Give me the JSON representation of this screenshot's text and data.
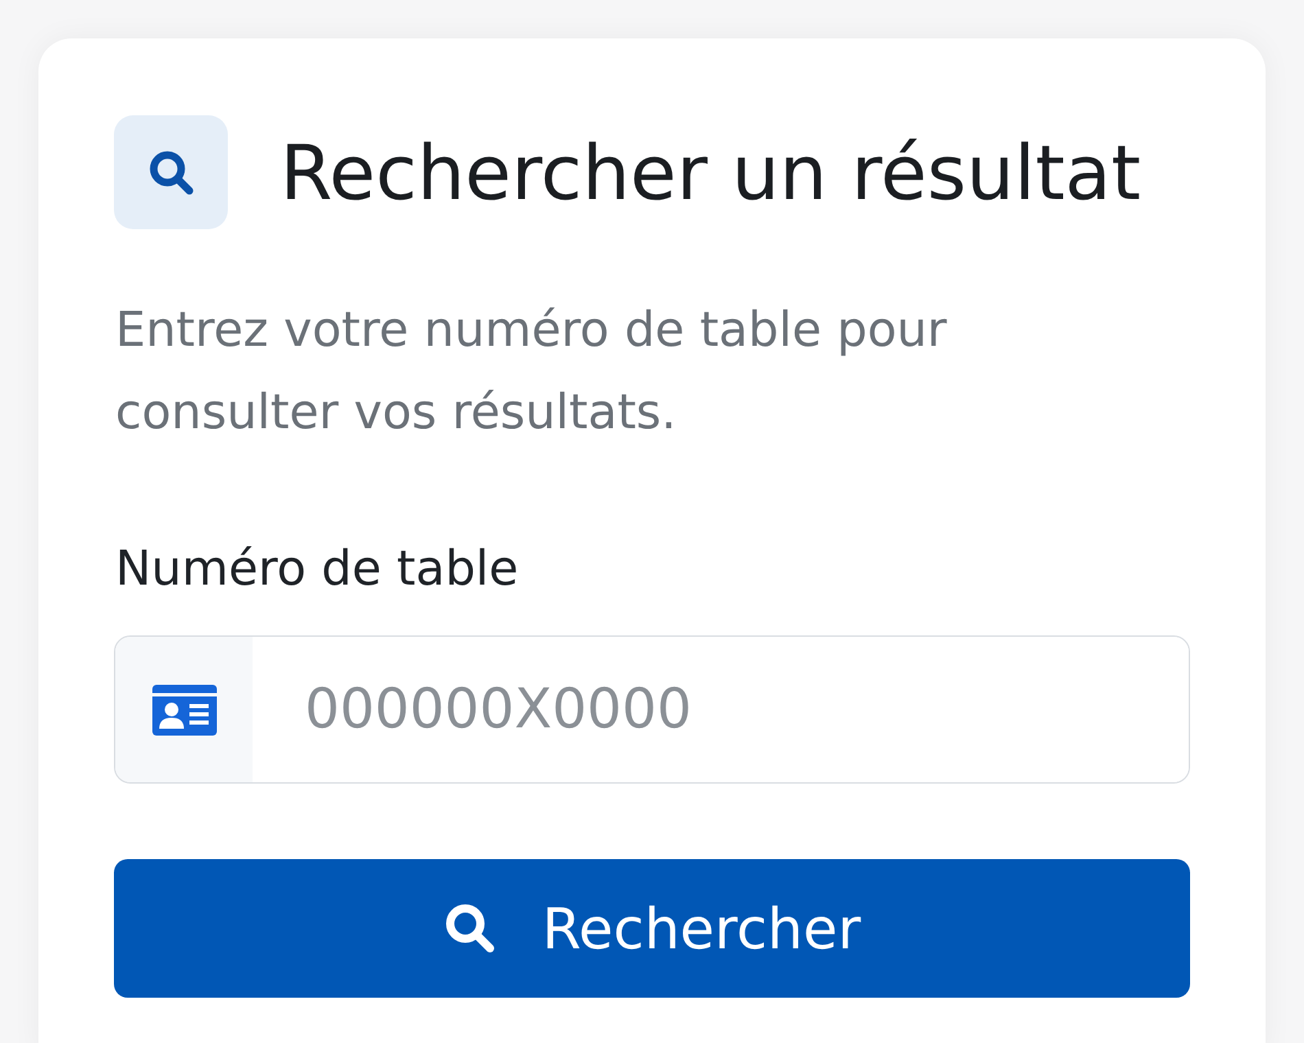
{
  "header": {
    "title": "Rechercher un résultat"
  },
  "description": "Entrez votre numéro de table pour consulter vos résultats.",
  "field": {
    "label": "Numéro de table",
    "placeholder": "000000X0000"
  },
  "submit_button": {
    "label": "Rechercher"
  }
}
